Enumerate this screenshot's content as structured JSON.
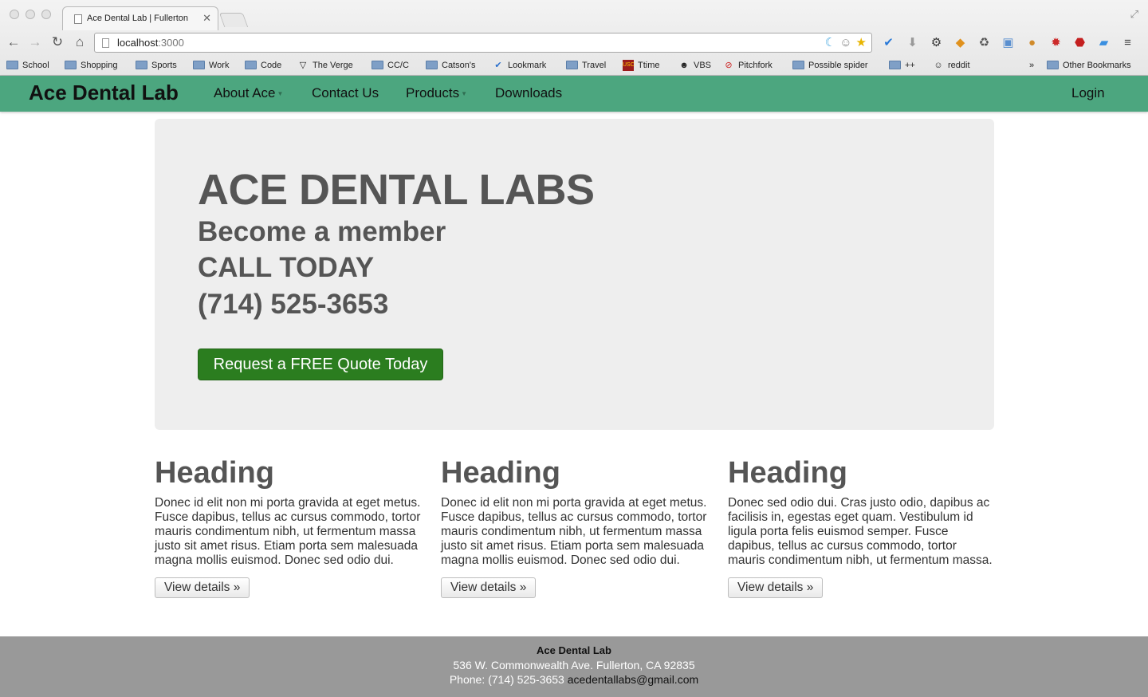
{
  "browser": {
    "tab_title": "Ace Dental Lab | Fullerton",
    "url_host": "localhost",
    "url_port": ":3000",
    "bookmarks": [
      {
        "label": "School",
        "icon": "folder-icon"
      },
      {
        "label": "Shopping",
        "icon": "folder-icon"
      },
      {
        "label": "Sports",
        "icon": "folder-icon"
      },
      {
        "label": "Work",
        "icon": "folder-icon"
      },
      {
        "label": "Code",
        "icon": "folder-icon"
      },
      {
        "label": "The Verge",
        "icon": "verge-icon"
      },
      {
        "label": "CC/C",
        "icon": "folder-icon"
      },
      {
        "label": "Catson's",
        "icon": "folder-icon"
      },
      {
        "label": "Lookmark",
        "icon": "lookmark-icon"
      },
      {
        "label": "Travel",
        "icon": "folder-icon"
      },
      {
        "label": "Ttime",
        "icon": "usc-icon"
      },
      {
        "label": "VBS",
        "icon": "vbs-icon"
      },
      {
        "label": "Pitchfork",
        "icon": "pitchfork-icon"
      },
      {
        "label": "Possible spider",
        "icon": "folder-icon"
      },
      {
        "label": "++",
        "icon": "folder-icon"
      },
      {
        "label": "reddit",
        "icon": "reddit-icon"
      }
    ],
    "overflow_chevron": "»",
    "other_bookmarks": "Other Bookmarks"
  },
  "navbar": {
    "brand": "Ace Dental Lab",
    "items": [
      "About Ace",
      "Contact Us",
      "Products",
      "Downloads"
    ],
    "login": "Login"
  },
  "jumbotron": {
    "title": "ACE DENTAL LABS",
    "line1": "Become a member",
    "line2": "CALL TODAY",
    "line3": "(714) 525-3653",
    "button": "Request a FREE Quote Today"
  },
  "columns": [
    {
      "heading": "Heading",
      "text": "Donec id elit non mi porta gravida at eget metus. Fusce dapibus, tellus ac cursus commodo, tortor mauris condimentum nibh, ut fermentum massa justo sit amet risus. Etiam porta sem malesuada magna mollis euismod. Donec sed odio dui.",
      "button": "View details »"
    },
    {
      "heading": "Heading",
      "text": "Donec id elit non mi porta gravida at eget metus. Fusce dapibus, tellus ac cursus commodo, tortor mauris condimentum nibh, ut fermentum massa justo sit amet risus. Etiam porta sem malesuada magna mollis euismod. Donec sed odio dui.",
      "button": "View details »"
    },
    {
      "heading": "Heading",
      "text": "Donec sed odio dui. Cras justo odio, dapibus ac facilisis in, egestas eget quam. Vestibulum id ligula porta felis euismod semper. Fusce dapibus, tellus ac cursus commodo, tortor mauris condimentum nibh, ut fermentum massa.",
      "button": "View details »"
    }
  ],
  "footer": {
    "name": "Ace Dental Lab",
    "address": "536 W. Commonwealth Ave. Fullerton, CA 92835",
    "phone": "Phone: (714) 525-3653",
    "email": "acedentallabs@gmail.com"
  },
  "colors": {
    "navbar": "#4ca67f",
    "quote_button": "#2b7d1f",
    "jumbotron_bg": "#eeeeee",
    "footer_bg": "#999999"
  }
}
